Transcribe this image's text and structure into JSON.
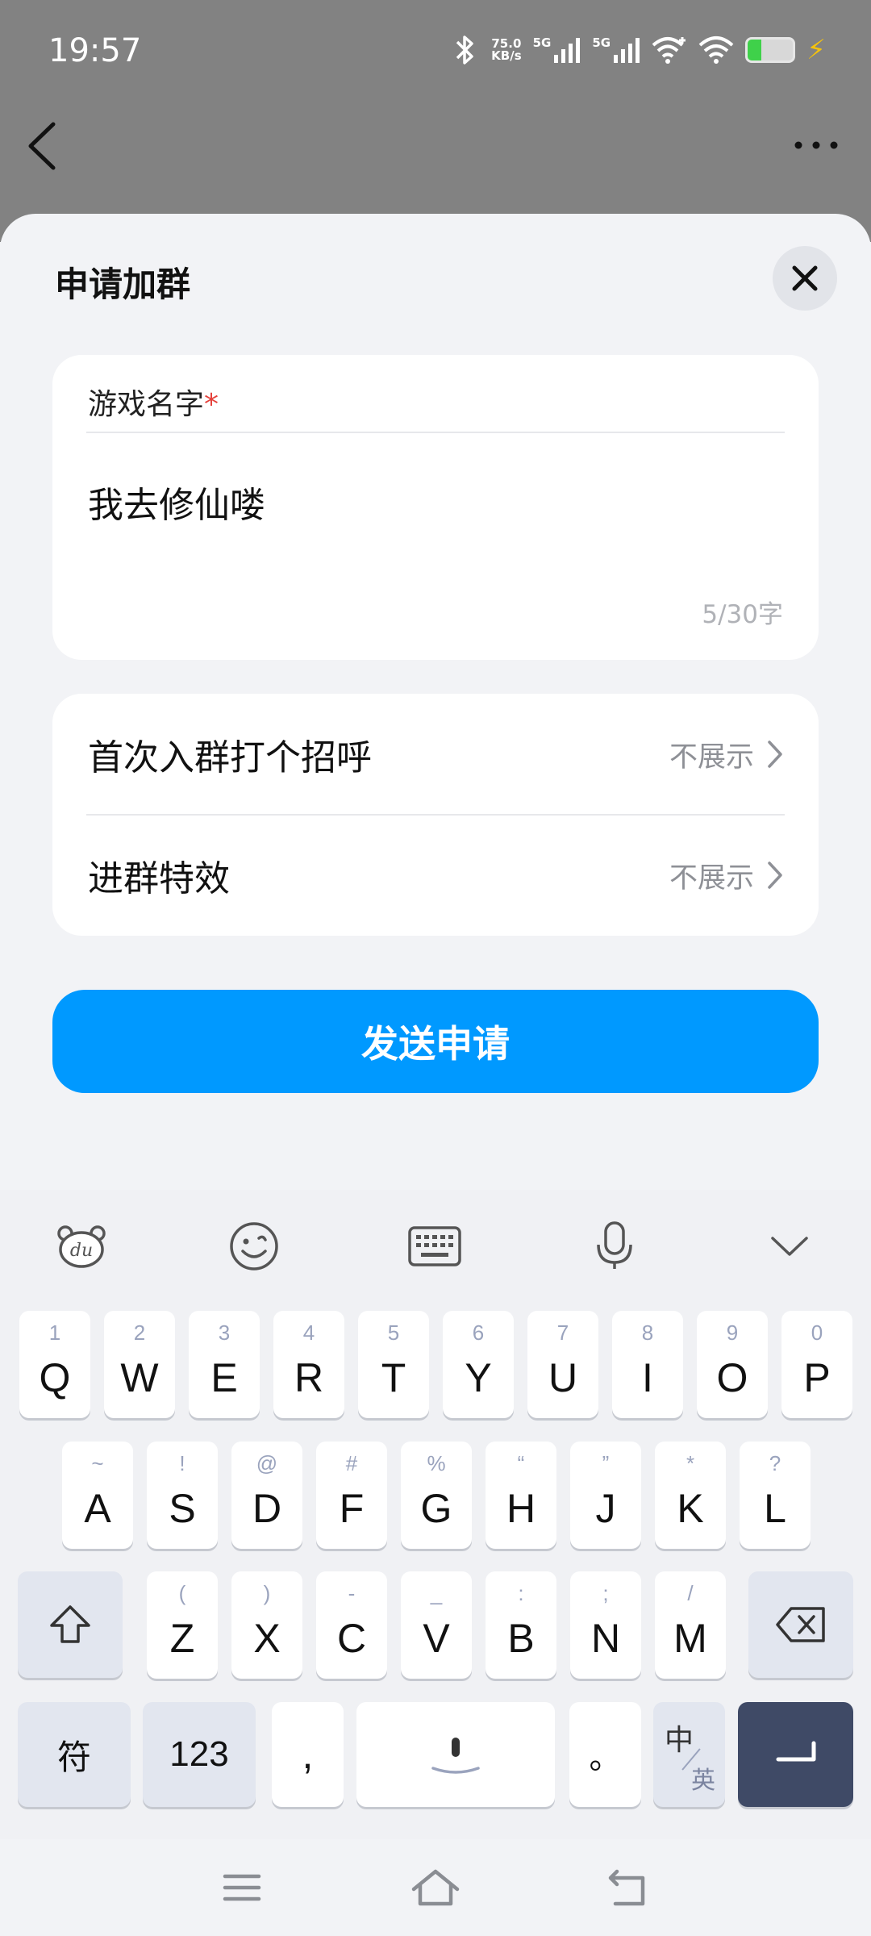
{
  "status_bar": {
    "time": "19:57",
    "net_speed": "75.0",
    "net_unit": "KB/s",
    "sim1": "5G",
    "sim2": "5G",
    "battery_level": 0.3
  },
  "sheet": {
    "title": "申请加群"
  },
  "game_name_field": {
    "label": "游戏名字",
    "required_mark": "*",
    "value": "我去修仙喽",
    "char_count": "5/30字"
  },
  "options": [
    {
      "label": "首次入群打个招呼",
      "value": "不展示"
    },
    {
      "label": "进群特效",
      "value": "不展示"
    }
  ],
  "submit_label": "发送申请",
  "keyboard": {
    "row1": [
      {
        "sub": "1",
        "key": "Q"
      },
      {
        "sub": "2",
        "key": "W"
      },
      {
        "sub": "3",
        "key": "E"
      },
      {
        "sub": "4",
        "key": "R"
      },
      {
        "sub": "5",
        "key": "T"
      },
      {
        "sub": "6",
        "key": "Y"
      },
      {
        "sub": "7",
        "key": "U"
      },
      {
        "sub": "8",
        "key": "I"
      },
      {
        "sub": "9",
        "key": "O"
      },
      {
        "sub": "0",
        "key": "P"
      }
    ],
    "row2": [
      {
        "sub": "~",
        "key": "A"
      },
      {
        "sub": "!",
        "key": "S"
      },
      {
        "sub": "@",
        "key": "D"
      },
      {
        "sub": "#",
        "key": "F"
      },
      {
        "sub": "%",
        "key": "G"
      },
      {
        "sub": "“",
        "key": "H"
      },
      {
        "sub": "”",
        "key": "J"
      },
      {
        "sub": "*",
        "key": "K"
      },
      {
        "sub": "?",
        "key": "L"
      }
    ],
    "row3": [
      {
        "sub": "(",
        "key": "Z"
      },
      {
        "sub": ")",
        "key": "X"
      },
      {
        "sub": "-",
        "key": "C"
      },
      {
        "sub": "_",
        "key": "V"
      },
      {
        "sub": ":",
        "key": "B"
      },
      {
        "sub": ";",
        "key": "N"
      },
      {
        "sub": "/",
        "key": "M"
      }
    ],
    "symbols_key": "符",
    "numbers_key": "123",
    "comma_key": ",",
    "period_key": "。",
    "lang_key_top": "中",
    "lang_key_bottom": "英"
  }
}
